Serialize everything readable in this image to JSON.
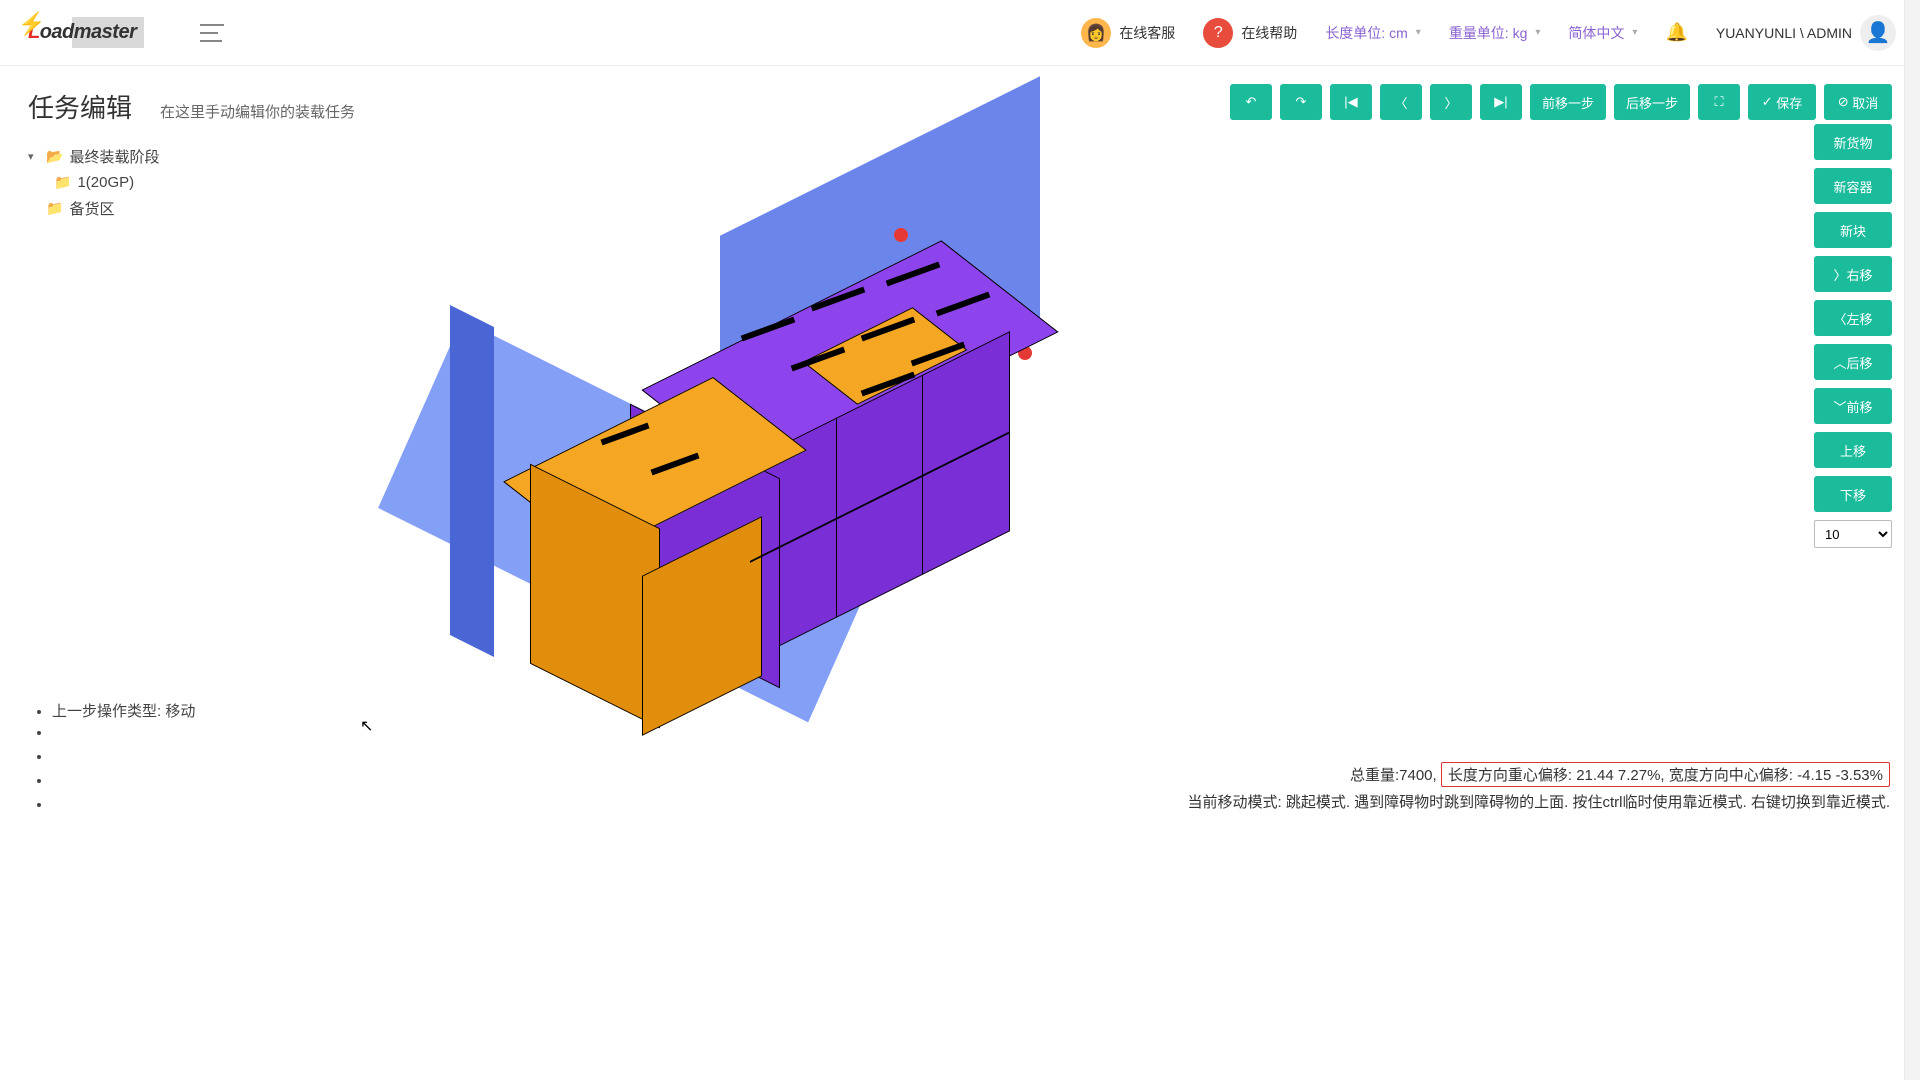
{
  "header": {
    "logo_text_1": "L",
    "logo_text_2": "oadmaster",
    "customer_service": "在线客服",
    "online_help": "在线帮助",
    "length_unit_label": "长度单位: cm",
    "weight_unit_label": "重量单位: kg",
    "language": "简体中文",
    "username": "YUANYUNLI \\ ADMIN"
  },
  "page": {
    "title": "任务编辑",
    "subtitle": "在这里手动编辑你的装载任务"
  },
  "tree": {
    "root": "最终装载阶段",
    "child1": "1(20GP)",
    "child2": "备货区"
  },
  "toolbar": {
    "step_prev": "前移一步",
    "step_next": "后移一步",
    "save": "保存",
    "cancel": "取消"
  },
  "side": {
    "new_cargo": "新货物",
    "new_container": "新容器",
    "new_block": "新块",
    "move_right": "右移",
    "move_left": "左移",
    "move_back": "后移",
    "move_front": "前移",
    "move_up": "上移",
    "move_down": "下移",
    "step_value": "10"
  },
  "info": {
    "last_op": "上一步操作类型: 移动"
  },
  "status": {
    "total_weight_label": "总重量:",
    "total_weight_value": "7400",
    "offset_text": "长度方向重心偏移: 21.44 7.27%, 宽度方向中心偏移: -4.15 -3.53%",
    "mode_text": "当前移动模式: 跳起模式. 遇到障碍物时跳到障碍物的上面. 按住ctrl临时使用靠近模式. 右键切换到靠近模式."
  }
}
